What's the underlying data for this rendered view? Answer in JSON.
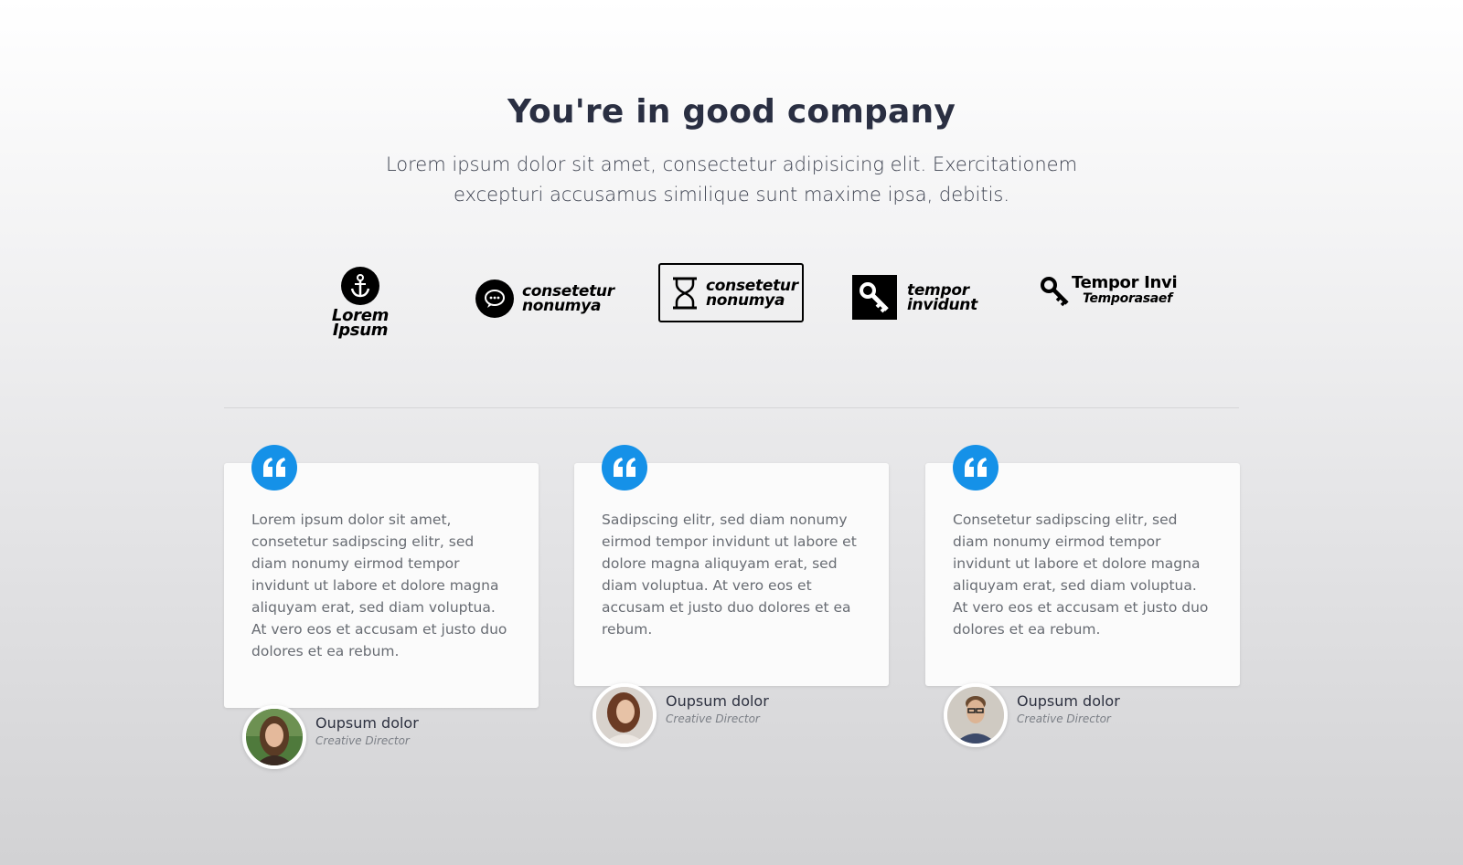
{
  "section": {
    "title": "You're in good company",
    "subtitle": "Lorem ipsum dolor sit amet, consectetur adipisicing elit. Exercitationem excepturi accusamus similique sunt maxime ipsa, debitis."
  },
  "logos": [
    {
      "line1": "Lorem Ipsum",
      "icon": "anchor-icon"
    },
    {
      "line1": "consetetur",
      "line2": "nonumya",
      "icon": "chat-bubble-icon"
    },
    {
      "line1": "consetetur",
      "line2": "nonumya",
      "icon": "hourglass-icon"
    },
    {
      "line1": "tempor",
      "line2": "invidunt",
      "icon": "key-icon"
    },
    {
      "line1": "Tempor Invi",
      "line2": "Temporasaef",
      "icon": "key-icon"
    }
  ],
  "testimonials": [
    {
      "text": "Lorem ipsum dolor sit amet, consetetur sadipscing elitr, sed diam nonumy eirmod tempor invidunt ut labore et dolore magna aliquyam erat, sed diam voluptua. At vero eos et accusam et justo duo dolores et ea rebum.",
      "name": "Oupsum dolor",
      "role": "Creative Director"
    },
    {
      "text": "Sadipscing elitr, sed diam nonumy eirmod tempor invidunt ut labore et dolore magna aliquyam erat, sed diam voluptua. At vero eos et accusam et justo duo dolores et ea rebum.",
      "name": "Oupsum dolor",
      "role": "Creative Director"
    },
    {
      "text": "Consetetur sadipscing elitr, sed diam nonumy eirmod tempor invidunt ut labore et dolore magna aliquyam erat, sed diam voluptua. At vero eos et accusam et justo duo dolores et ea rebum.",
      "name": "Oupsum dolor",
      "role": "Creative Director"
    }
  ],
  "colors": {
    "accent": "#1591e8",
    "heading": "#2a2f42",
    "body_text": "#686c73"
  }
}
